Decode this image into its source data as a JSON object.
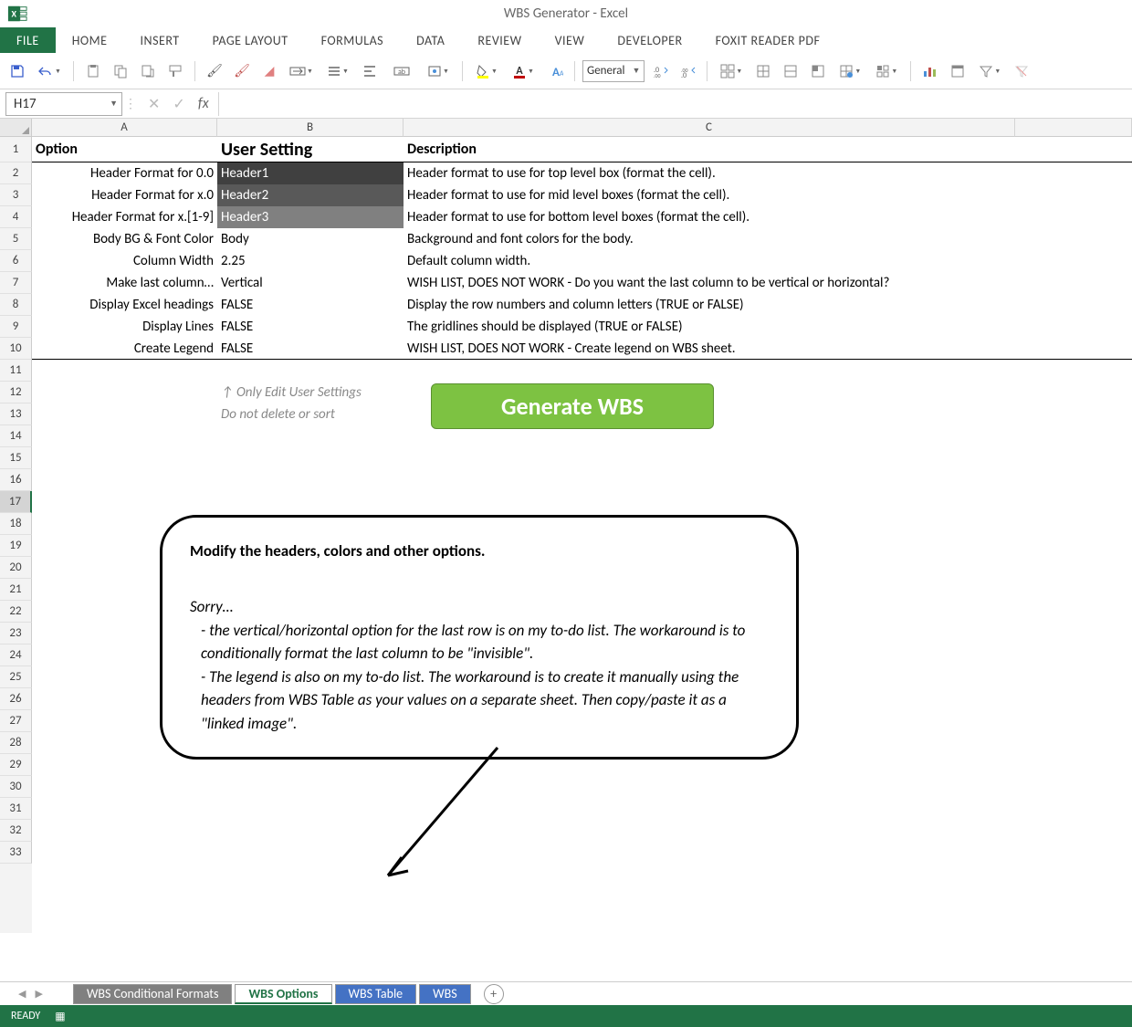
{
  "title": "WBS Generator - Excel",
  "ribbon": {
    "tabs": [
      "FILE",
      "HOME",
      "INSERT",
      "PAGE LAYOUT",
      "FORMULAS",
      "DATA",
      "REVIEW",
      "VIEW",
      "DEVELOPER",
      "FOXIT READER PDF"
    ]
  },
  "toolbar": {
    "number_format": "General"
  },
  "namebox": "H17",
  "formula": "",
  "columns": [
    "A",
    "B",
    "C"
  ],
  "headers": {
    "option": "Option",
    "user_setting": "User Setting",
    "description": "Description"
  },
  "rows": [
    {
      "opt": "Header Format for 0.0",
      "val": "Header1",
      "desc": "Header format to use for top level box (format the cell).",
      "style": "h1"
    },
    {
      "opt": "Header Format for x.0",
      "val": "Header2",
      "desc": "Header format to use for mid level boxes (format the cell).",
      "style": "h2"
    },
    {
      "opt": "Header Format for x.[1-9]",
      "val": "Header3",
      "desc": "Header format to use for bottom level boxes (format the cell).",
      "style": "h3"
    },
    {
      "opt": "Body BG & Font Color",
      "val": "Body",
      "desc": "Background and font colors for the body.",
      "style": ""
    },
    {
      "opt": "Column Width",
      "val": "2.25",
      "desc": "Default column width.",
      "style": ""
    },
    {
      "opt": "Make last column…",
      "val": "Vertical",
      "desc": "WISH LIST, DOES NOT WORK - Do you want the last column to be vertical or horizontal?",
      "style": ""
    },
    {
      "opt": "Display Excel headings",
      "val": "FALSE",
      "desc": "Display the row numbers and column letters (TRUE or FALSE)",
      "style": ""
    },
    {
      "opt": "Display Lines",
      "val": "FALSE",
      "desc": "The gridlines should be displayed (TRUE or FALSE)",
      "style": ""
    },
    {
      "opt": "Create Legend",
      "val": "FALSE",
      "desc": "WISH LIST, DOES NOT WORK - Create legend on WBS sheet.",
      "style": ""
    }
  ],
  "hint": {
    "line1": "↑ Only Edit User Settings",
    "line2": "Do not delete or sort"
  },
  "button": "Generate WBS",
  "callout": {
    "title": "Modify the headers, colors and other options.",
    "sorry": "Sorry…",
    "items": [
      "the vertical/horizontal option for the last row is on my to-do list. The workaround is to conditionally format the last column to be \"invisible\".",
      "The legend is also on my to-do list. The workaround is to create it manually using the headers from WBS Table as your values on a separate sheet. Then copy/paste it as a \"linked image\"."
    ]
  },
  "sheets": [
    "WBS Conditional Formats",
    "WBS Options",
    "WBS Table",
    "WBS"
  ],
  "status": "READY"
}
